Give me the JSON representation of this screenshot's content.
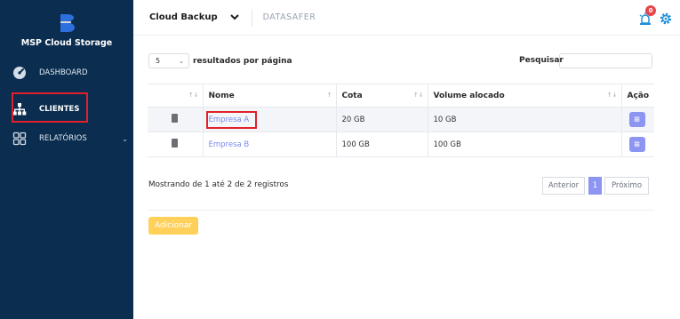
{
  "brand": {
    "name": "MSP Cloud Storage",
    "logo_color": "#2d6fdc"
  },
  "sidebar": {
    "items": [
      {
        "label": "DASHBOARD",
        "icon": "dashboard-gauge-icon"
      },
      {
        "label": "CLIENTES",
        "icon": "sitemap-icon",
        "active": true
      },
      {
        "label": "RELATÓRIOS",
        "icon": "grid-reports-icon",
        "has_submenu": true
      }
    ]
  },
  "topbar": {
    "app_name": "Cloud Backup",
    "dropdown_icon": "chevron-down-icon",
    "product": "DATASAFER",
    "notifications_count": "0",
    "accent": "#1f8fd6"
  },
  "controls": {
    "page_length": "5",
    "page_length_label": "resultados por página",
    "search_label": "Pesquisar",
    "search_value": ""
  },
  "table": {
    "headers": [
      "",
      "Nome",
      "Cota",
      "Volume alocado",
      "Ação"
    ],
    "rows": [
      {
        "name": "Empresa A",
        "quota": "20 GB",
        "volume": "10 GB"
      },
      {
        "name": "Empresa B",
        "quota": "100 GB",
        "volume": "100 GB"
      }
    ]
  },
  "footer": {
    "info": "Mostrando de 1 até 2 de 2 registros",
    "prev": "Anterior",
    "page": "1",
    "next": "Próximo",
    "add_button": "Adicionar"
  },
  "colors": {
    "sidebar_bg": "#0b2d4f",
    "link": "#7c8bf0",
    "action_button": "#8d95f3",
    "add_button": "#ffd15a",
    "highlight": "#e0202a"
  }
}
